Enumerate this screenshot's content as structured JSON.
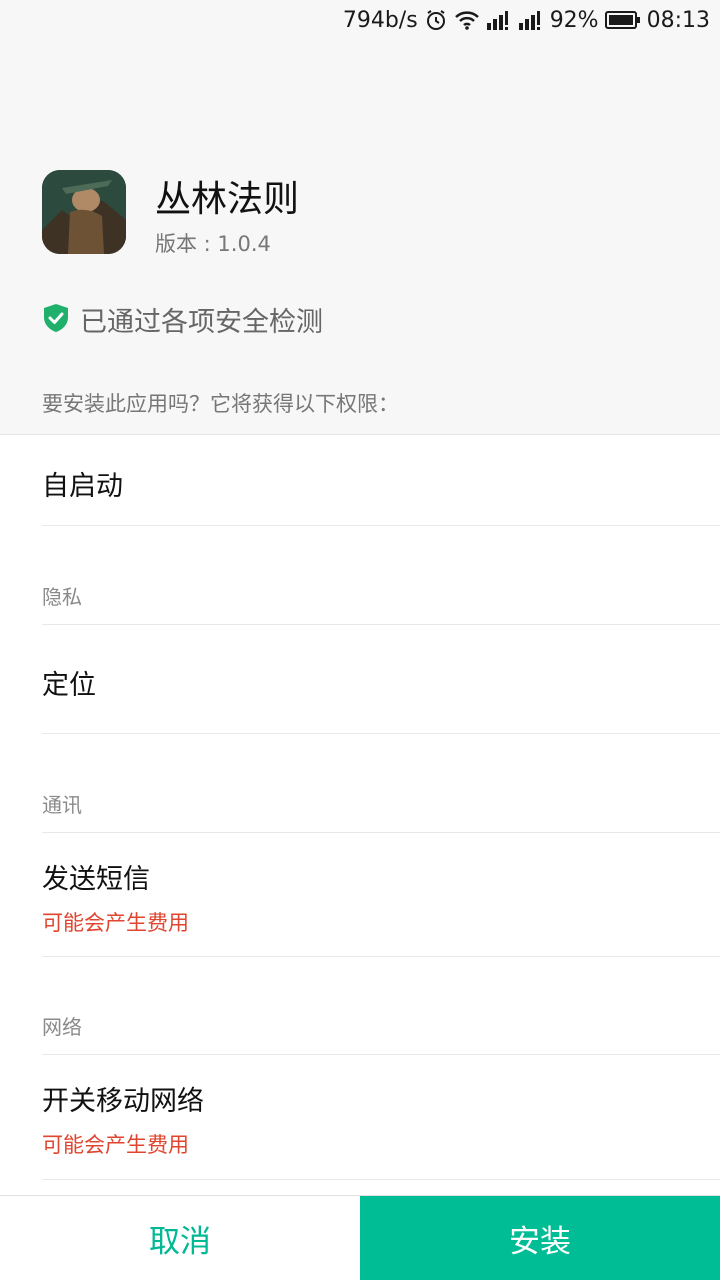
{
  "status_bar": {
    "net_speed": "794b/s",
    "battery": "92%",
    "time": "08:13",
    "icons": [
      "alarm-icon",
      "wifi-icon",
      "signal-icon",
      "signal-icon",
      "battery-icon"
    ]
  },
  "app": {
    "name": "丛林法则",
    "version": "版本 : 1.0.4",
    "icon": "app-icon"
  },
  "security": {
    "icon": "shield-check-icon",
    "text": "已通过各项安全检测",
    "color": "#1fb16b"
  },
  "prompt": "要安装此应用吗？它将获得以下权限：",
  "permissions": {
    "autostart": {
      "title": "自启动"
    },
    "privacy_label": "隐私",
    "location": {
      "title": "定位"
    },
    "comm_label": "通讯",
    "sms": {
      "title": "发送短信",
      "warning": "可能会产生费用"
    },
    "network_label": "网络",
    "mobile_net": {
      "title": "开关移动网络",
      "warning": "可能会产生费用"
    }
  },
  "buttons": {
    "cancel": "取消",
    "install": "安装"
  },
  "colors": {
    "accent": "#00bd96",
    "warning": "#e0452f"
  }
}
